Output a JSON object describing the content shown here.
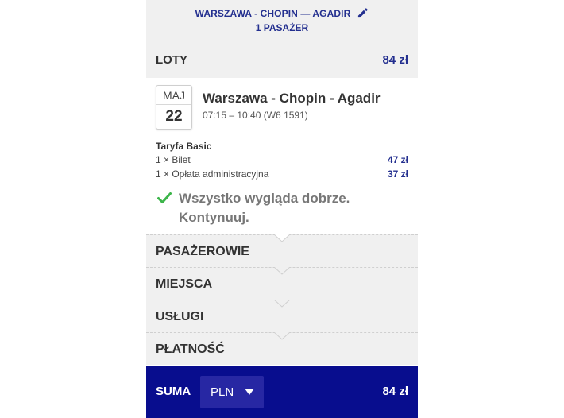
{
  "header": {
    "route": "WARSZAWA - CHOPIN — AGADIR",
    "passengers": "1 PASAŻER",
    "edit_icon": "pencil-icon"
  },
  "flights": {
    "label": "LOTY",
    "price": "84 zł",
    "flight": {
      "month": "MAJ",
      "day": "22",
      "title": "Warszawa - Chopin - Agadir",
      "time": "07:15 – 10:40 (W6 1591)"
    },
    "fare": {
      "name": "Taryfa Basic",
      "items": [
        {
          "label": "1 × Bilet",
          "amount": "47 zł"
        },
        {
          "label": "1 × Opłata administracyjna",
          "amount": "37 zł"
        }
      ]
    },
    "status": {
      "icon": "checkmark-icon",
      "text": "Wszystko wygląda dobrze. Kontynuuj."
    }
  },
  "steps": [
    "PASAŻEROWIE",
    "MIEJSCA",
    "USŁUGI",
    "PŁATNOŚĆ"
  ],
  "total": {
    "label": "SUMA",
    "currency": "PLN",
    "amount": "84 zł"
  },
  "colors": {
    "accent": "#232f8f",
    "total_bar": "#080d8e",
    "currency_select": "#2727a3",
    "success": "#3cb54a",
    "section_bg": "#f0f0f0"
  }
}
